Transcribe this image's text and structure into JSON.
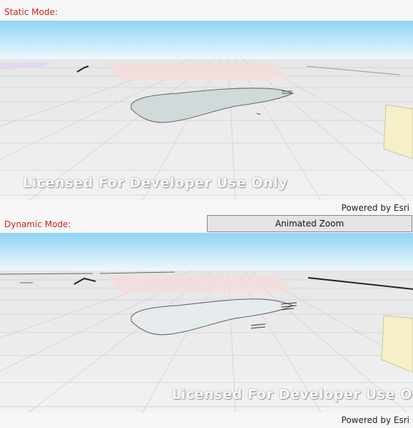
{
  "static_panel": {
    "label": "Static Mode:",
    "watermark": "Licensed For Developer Use Only",
    "attribution": "Powered by Esri"
  },
  "dynamic_panel": {
    "label": "Dynamic Mode:",
    "watermark": "Licensed For Developer Use Only",
    "attribution": "Powered by Esri",
    "zoom_button_label": "Animated Zoom"
  },
  "colors": {
    "mode_label": "#d0201a",
    "sky_top": "#8fd3f5",
    "sky_horizon": "#eef8fd",
    "ground": "#efefef",
    "grid_line": "#d8d8d8",
    "parcel_fill": "#cfd8da",
    "pink_area": "#f6dcdc",
    "yellow_building": "#f5f0c8"
  }
}
